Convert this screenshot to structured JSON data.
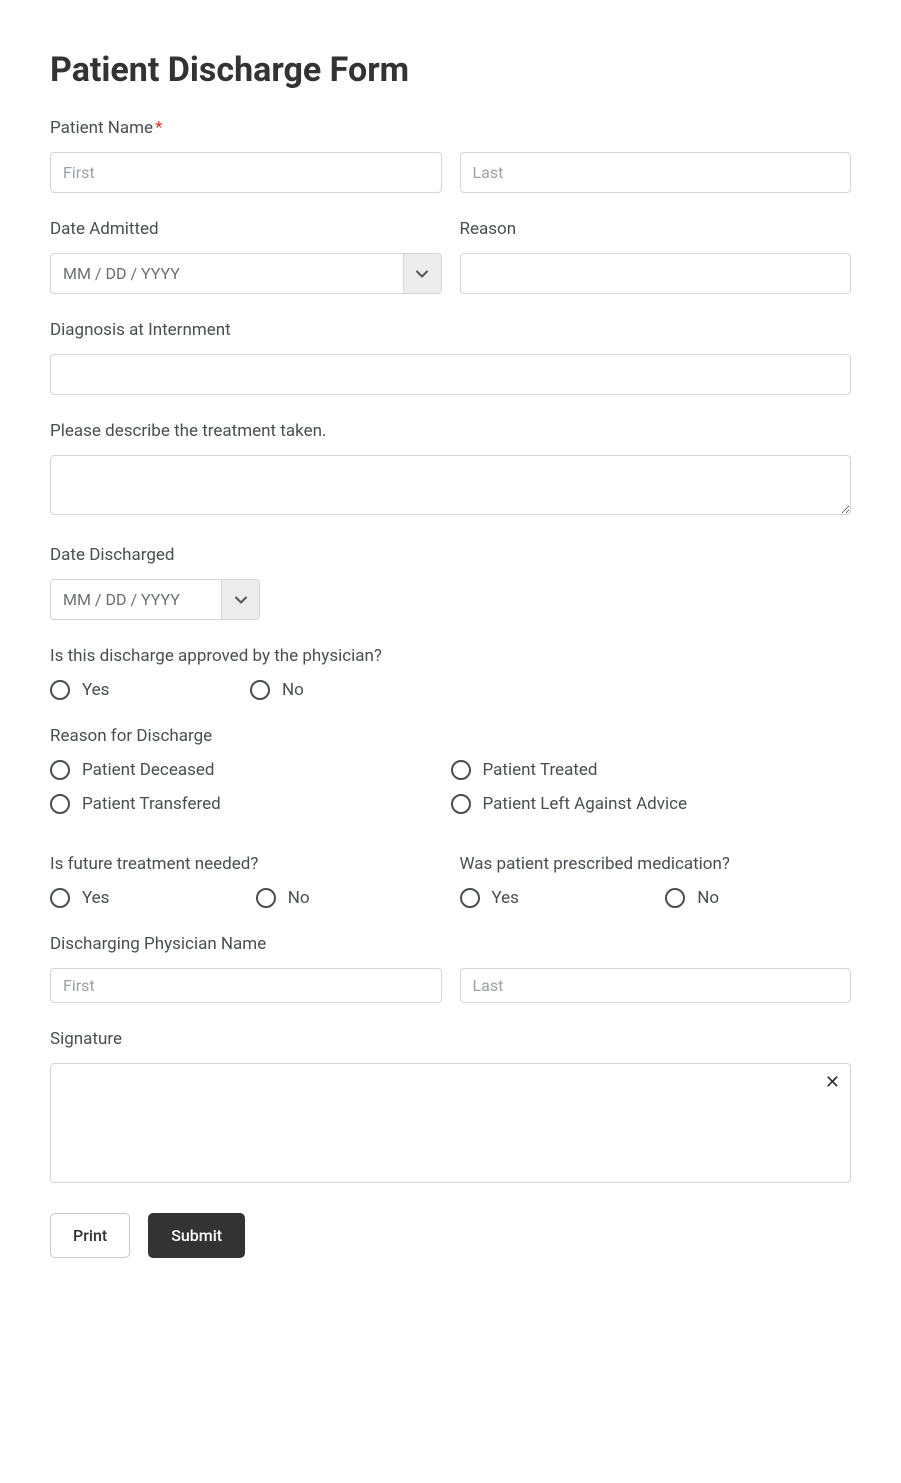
{
  "title": "Patient Discharge Form",
  "patientName": {
    "label": "Patient Name",
    "firstPlaceholder": "First",
    "lastPlaceholder": "Last"
  },
  "dateAdmitted": {
    "label": "Date Admitted",
    "placeholder": "MM / DD / YYYY"
  },
  "reason": {
    "label": "Reason"
  },
  "diagnosis": {
    "label": "Diagnosis at Internment"
  },
  "treatment": {
    "label": "Please describe the treatment taken."
  },
  "dateDischarged": {
    "label": "Date Discharged",
    "placeholder": "MM / DD / YYYY"
  },
  "approved": {
    "label": "Is this discharge approved by the physician?",
    "options": [
      "Yes",
      "No"
    ]
  },
  "dischargeReason": {
    "label": "Reason for Discharge",
    "options": [
      "Patient Deceased",
      "Patient Treated",
      "Patient Transfered",
      "Patient Left Against Advice"
    ]
  },
  "futureTreatment": {
    "label": "Is future treatment needed?",
    "options": [
      "Yes",
      "No"
    ]
  },
  "prescribed": {
    "label": "Was patient prescribed medication?",
    "options": [
      "Yes",
      "No"
    ]
  },
  "physicianName": {
    "label": "Discharging Physician Name",
    "firstPlaceholder": "First",
    "lastPlaceholder": "Last"
  },
  "signature": {
    "label": "Signature"
  },
  "buttons": {
    "print": "Print",
    "submit": "Submit"
  }
}
